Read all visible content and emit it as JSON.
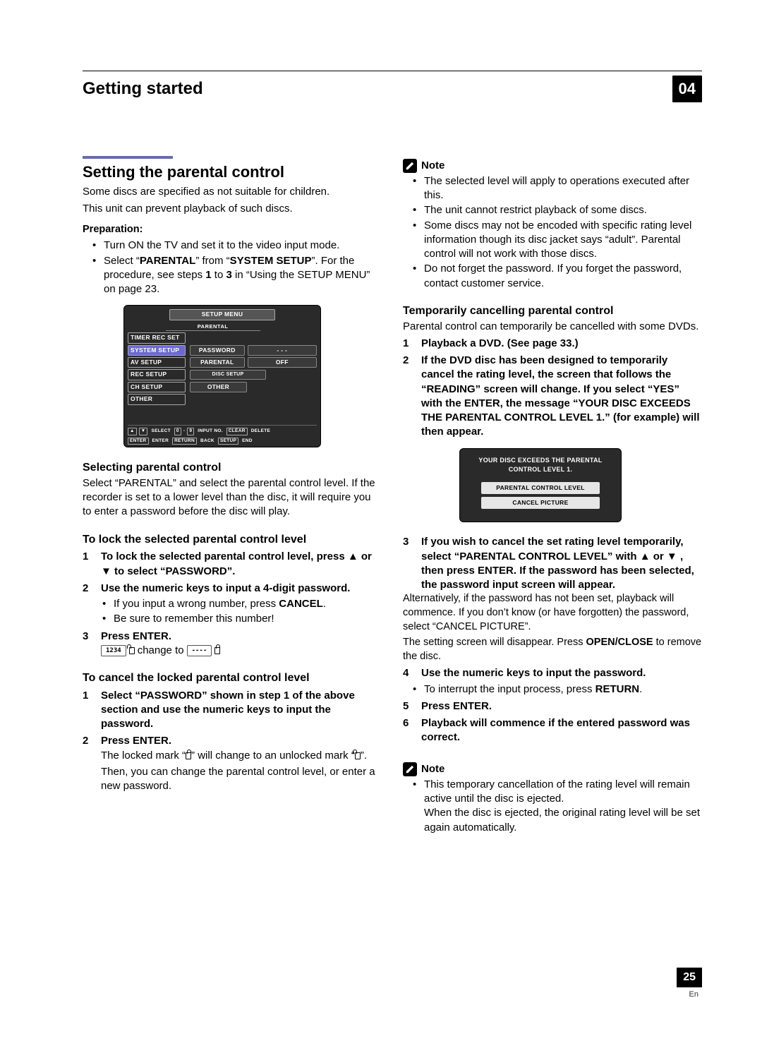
{
  "header": {
    "chapter_title": "Getting started",
    "chapter_number": "04"
  },
  "left": {
    "h2": "Setting the parental control",
    "intro1": "Some discs are specified as not suitable for children.",
    "intro2": "This unit can prevent playback of such discs.",
    "prep_head": "Preparation:",
    "prep1": "Turn ON the TV and set it to the video input mode.",
    "prep2a": "Select “",
    "prep2b": "PARENTAL",
    "prep2c": "” from “",
    "prep2d": "SYSTEM SETUP",
    "prep2e": "”. For the procedure, see steps ",
    "prep2f": "1",
    "prep2g": " to ",
    "prep2h": "3",
    "prep2i": " in “Using the SETUP MENU” on page 23.",
    "osd": {
      "title": "SETUP MENU",
      "rows": [
        "TIMER REC SET",
        "SYSTEM SETUP",
        "AV SETUP",
        "REC SETUP",
        "CH SETUP",
        "OTHER"
      ],
      "section": "PARENTAL",
      "r_password": "PASSWORD",
      "r_pwval": "- - -",
      "r_parental": "PARENTAL",
      "r_parval": "OFF",
      "r_disc": "DISC SETUP",
      "r_other": "OTHER",
      "hints": [
        "▲",
        "▼",
        "SELECT",
        "0",
        "9",
        "INPUT NO.",
        "CLEAR",
        "DELETE",
        "ENTER",
        "ENTER",
        "RETURN",
        "BACK",
        "SETUP",
        "END"
      ]
    },
    "sel_h3": "Selecting parental control",
    "sel_p": "Select “PARENTAL” and select the parental control level. If the recorder is set to a lower level than the disc, it will require you to enter a password before the disc will play.",
    "lock_h3": "To lock the selected parental control level",
    "lock1": "To lock the selected parental control level, press ▲ or ▼ to select “PASSWORD”.",
    "lock2": "Use the numeric keys to input a 4-digit password.",
    "lock2a_a": "If you input a wrong number, press ",
    "lock2a_b": "CANCEL",
    "lock2a_c": ".",
    "lock2b": "Be sure to remember this number!",
    "lock3": "Press ENTER.",
    "lock3_from": "1234",
    "lock3_mid": " change to ",
    "lock3_to": "----",
    "cancel_h3": "To cancel the locked parental control level",
    "cancel1": "Select “PASSWORD” shown in step 1 of the above section and use the numeric keys to input the password.",
    "cancel2": "Press ENTER.",
    "cancel2_a": "The locked mark “",
    "cancel2_b": "” will change to an unlocked mark “",
    "cancel2_c": "”.",
    "cancel2_d": "Then, you can change the parental control level, or enter a new password."
  },
  "right": {
    "note_label": "Note",
    "n1": "The selected level will apply to operations executed after this.",
    "n2": "The unit cannot restrict playback of some discs.",
    "n3": "Some discs may not be encoded with specific rating level information though its disc jacket says “adult”. Parental control will not work with those discs.",
    "n4": "Do not forget the password. If you forget the password, contact customer service.",
    "temp_h3": "Temporarily cancelling parental control",
    "temp_p": "Parental control can temporarily be cancelled with some DVDs.",
    "t1": "Playback a DVD. (See page 33.)",
    "t2": "If the DVD disc has been designed to temporarily cancel the rating level, the screen that follows the “READING” screen will change. If you select “YES” with the ENTER, the message “YOUR DISC EXCEEDS THE PARENTAL CONTROL LEVEL 1.” (for example) will then appear.",
    "osd2_msg": "YOUR DISC EXCEEDS THE PARENTAL CONTROL LEVEL 1.",
    "osd2_b1": "PARENTAL CONTROL LEVEL",
    "osd2_b2": "CANCEL PICTURE",
    "t3": "If you wish to cancel the set rating level temporarily, select “PARENTAL CONTROL LEVEL” with ▲ or ▼ , then press ENTER. If the password has been selected, the password input screen will appear.",
    "t3a": "Alternatively, if the password has not been set, playback will commence. If you don’t know (or have forgotten) the password, select “CANCEL PICTURE”.",
    "t3b_a": "The setting screen will disappear. Press ",
    "t3b_b": "OPEN/CLOSE",
    "t3b_c": " to remove the disc.",
    "t4": "Use the numeric keys to input the password.",
    "t4a_a": "To interrupt the input process, press ",
    "t4a_b": "RETURN",
    "t4a_c": ".",
    "t5": "Press ENTER.",
    "t6": "Playback will commence if the entered password was correct.",
    "note2_label": "Note",
    "note2_a": "This temporary cancellation of the rating level will remain active until the disc is ejected.",
    "note2_b": "When the disc is ejected, the original rating level will be set again automatically."
  },
  "footer": {
    "page": "25",
    "lang": "En"
  }
}
